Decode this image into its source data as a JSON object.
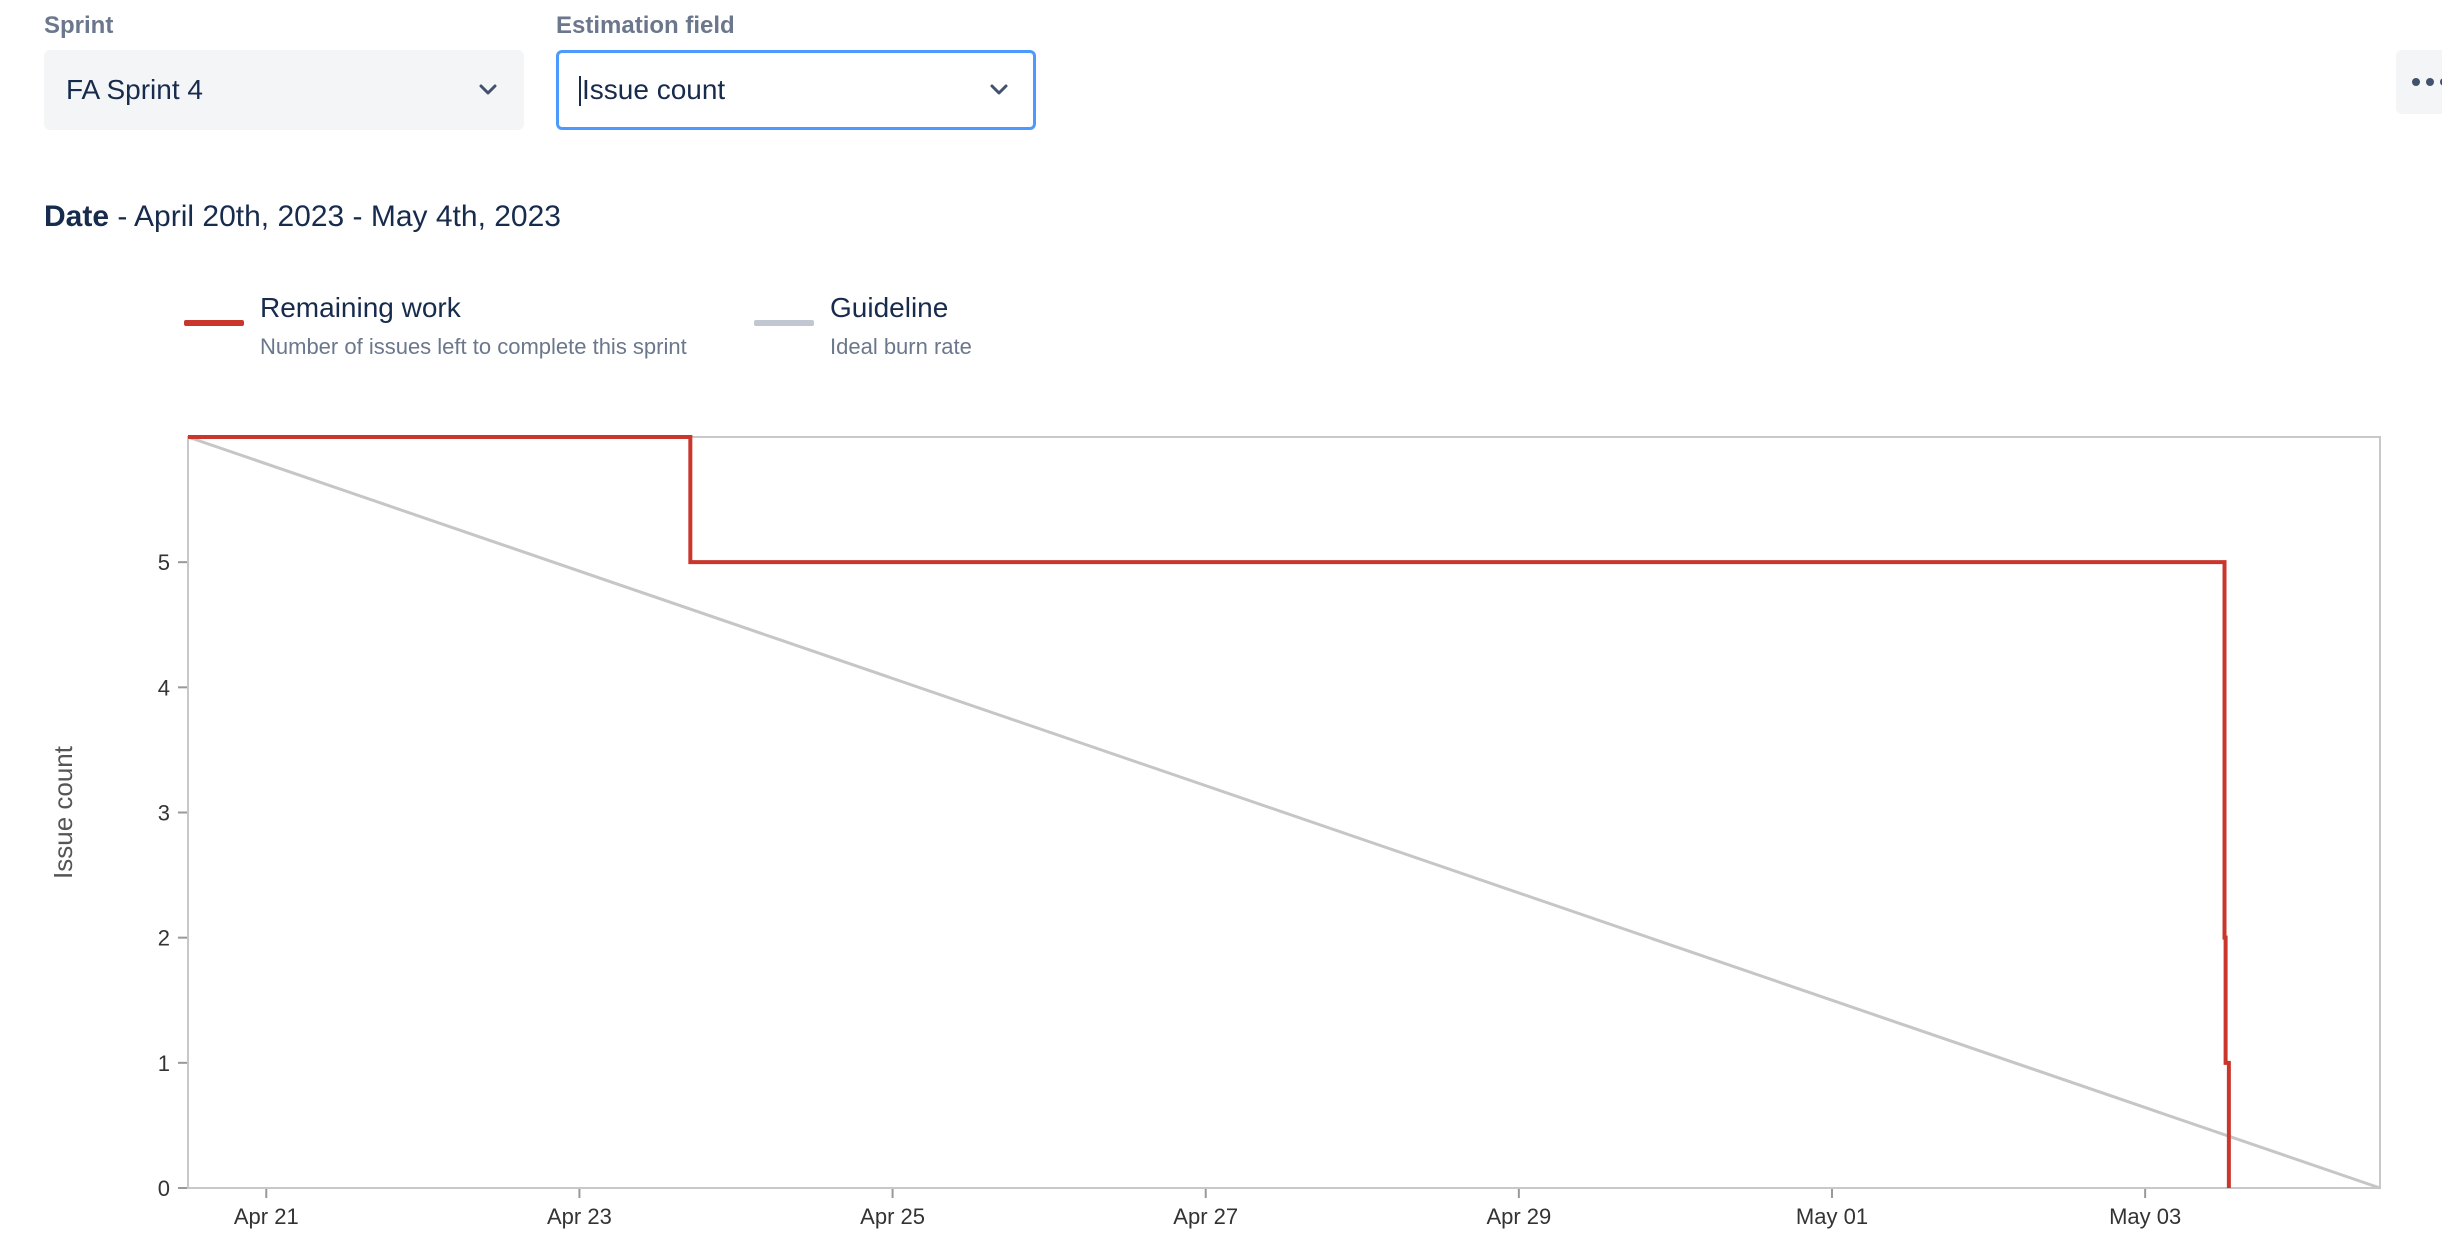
{
  "filters": {
    "sprint": {
      "label": "Sprint",
      "value": "FA Sprint 4"
    },
    "estimation": {
      "label": "Estimation field",
      "value": "Issue count"
    }
  },
  "icons": {
    "chevron": "chevron-down-icon",
    "more": "more-horizontal-icon"
  },
  "date_range": {
    "label": "Date",
    "separator": " - ",
    "value": "April 20th, 2023 - May 4th, 2023"
  },
  "legend": [
    {
      "title": "Remaining work",
      "description": "Number of issues left to complete this sprint",
      "color": "#c9372c"
    },
    {
      "title": "Guideline",
      "description": "Ideal burn rate",
      "color": "#c1c7d0"
    }
  ],
  "colors": {
    "accent": "#4c9aff",
    "text": "#172b4d",
    "muted": "#6b778c"
  },
  "chart_data": {
    "type": "line",
    "xlabel": "",
    "ylabel": "Issue count",
    "x_range": [
      "2023-04-20T12:00",
      "2023-05-04T12:00"
    ],
    "ylim": [
      0,
      6
    ],
    "x_ticks": [
      {
        "date": "2023-04-21T00:00",
        "label": "Apr 21"
      },
      {
        "date": "2023-04-23T00:00",
        "label": "Apr 23"
      },
      {
        "date": "2023-04-25T00:00",
        "label": "Apr 25"
      },
      {
        "date": "2023-04-27T00:00",
        "label": "Apr 27"
      },
      {
        "date": "2023-04-29T00:00",
        "label": "Apr 29"
      },
      {
        "date": "2023-05-01T00:00",
        "label": "May 01"
      },
      {
        "date": "2023-05-03T00:00",
        "label": "May 03"
      }
    ],
    "y_ticks": [
      0,
      1,
      2,
      3,
      4,
      5
    ],
    "series": [
      {
        "name": "Remaining work",
        "color": "#c9372c",
        "step": true,
        "points": [
          {
            "x": "2023-04-20T12:00",
            "y": 6
          },
          {
            "x": "2023-04-23T17:00",
            "y": 5
          },
          {
            "x": "2023-05-03T12:10",
            "y": 2
          },
          {
            "x": "2023-05-03T12:20",
            "y": 1
          },
          {
            "x": "2023-05-03T12:50",
            "y": 0
          }
        ]
      },
      {
        "name": "Guideline",
        "color": "#c6c6c6",
        "step": false,
        "points": [
          {
            "x": "2023-04-20T12:00",
            "y": 6
          },
          {
            "x": "2023-05-04T12:00",
            "y": 0
          }
        ]
      }
    ]
  }
}
